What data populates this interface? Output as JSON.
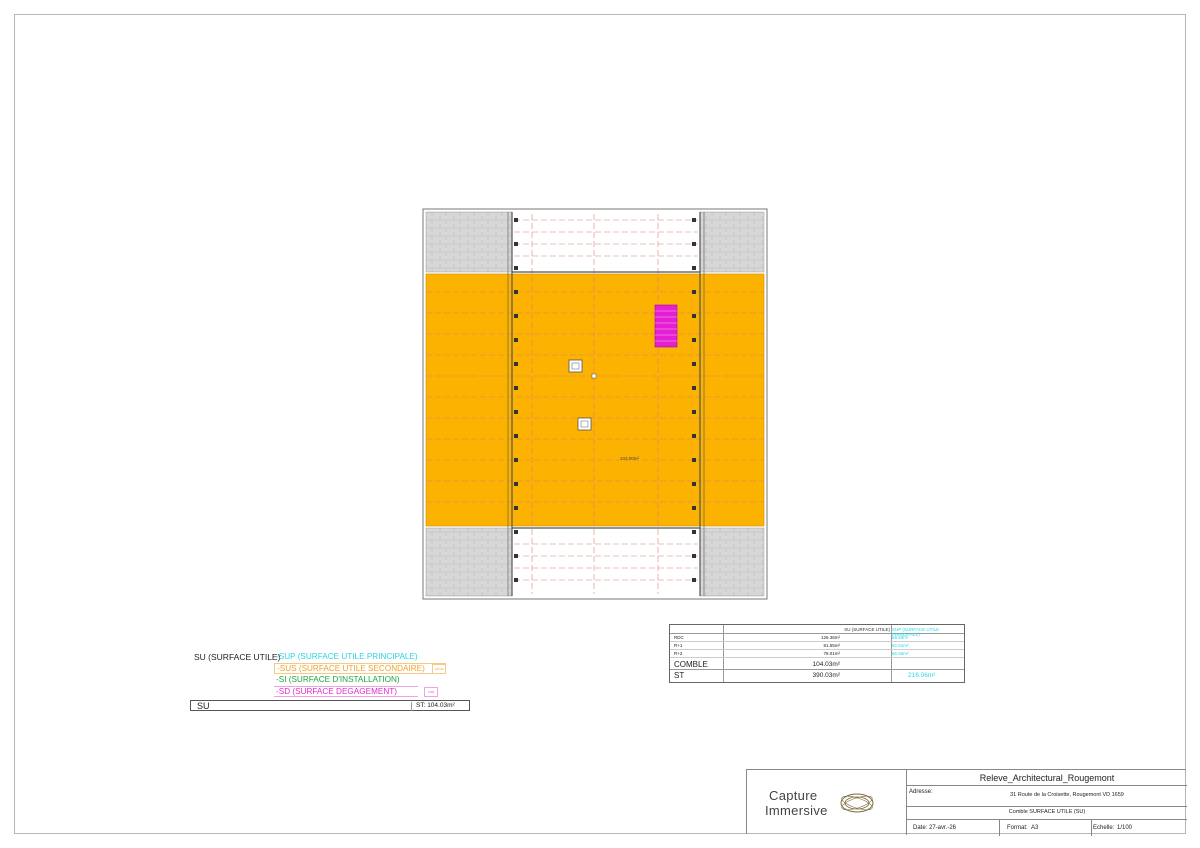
{
  "plan": {
    "area_label": "103.00m²",
    "colors": {
      "su_fill": "#fbb200",
      "sd_fill": "#e51fd3",
      "hatch_fill": "#d7d7d7",
      "dashed_line": "#d9847a"
    }
  },
  "legend": {
    "title": "SU (SURFACE UTILE)",
    "sup": "-SUP (SURFACE UTILE PRINCIPALE)",
    "sus": "-SUS (SURFACE UTILE SECONDAIRE)",
    "si": "-SI (SURFACE D'INSTALLATION)",
    "sd": "-SD (SURFACE DEGAGEMENT)",
    "sus_box": "103.00",
    "sd_box": "1.03",
    "total_label": "SU",
    "total_value": "ST: 104.03m²"
  },
  "area_table": {
    "header_su": "SU (SURFACE UTILE)",
    "header_sup": "SUP (SURFACE UTILE PRINCIPALE)",
    "rows": [
      {
        "level": "RDC",
        "su": "126.36m²",
        "sup": "68.50m²"
      },
      {
        "level": "R+1",
        "su": "81.55m²",
        "sup": "82.01m²"
      },
      {
        "level": "R+2",
        "su": "78.01m²",
        "sup": "66.55m²"
      }
    ],
    "comble_label": "COMBLE",
    "comble_su": "104.03m²",
    "st_label": "ST",
    "st_su": "390.03m²",
    "st_sup": "216.06m²"
  },
  "title_block": {
    "logo_line1": "Capture",
    "logo_line2": "Immersive",
    "project": "Releve_Architectural_Rougemont",
    "address_label": "Adresse:",
    "address": "31 Route de la Croisette, Rougemont VD 1659",
    "sheet_title": "Comble SURFACE UTILE (SU)",
    "date_label": "Date:",
    "date": "27-avr.-26",
    "format_label": "Format:",
    "format": "A3",
    "scale_label": "Echelle:",
    "scale": "1/100"
  }
}
